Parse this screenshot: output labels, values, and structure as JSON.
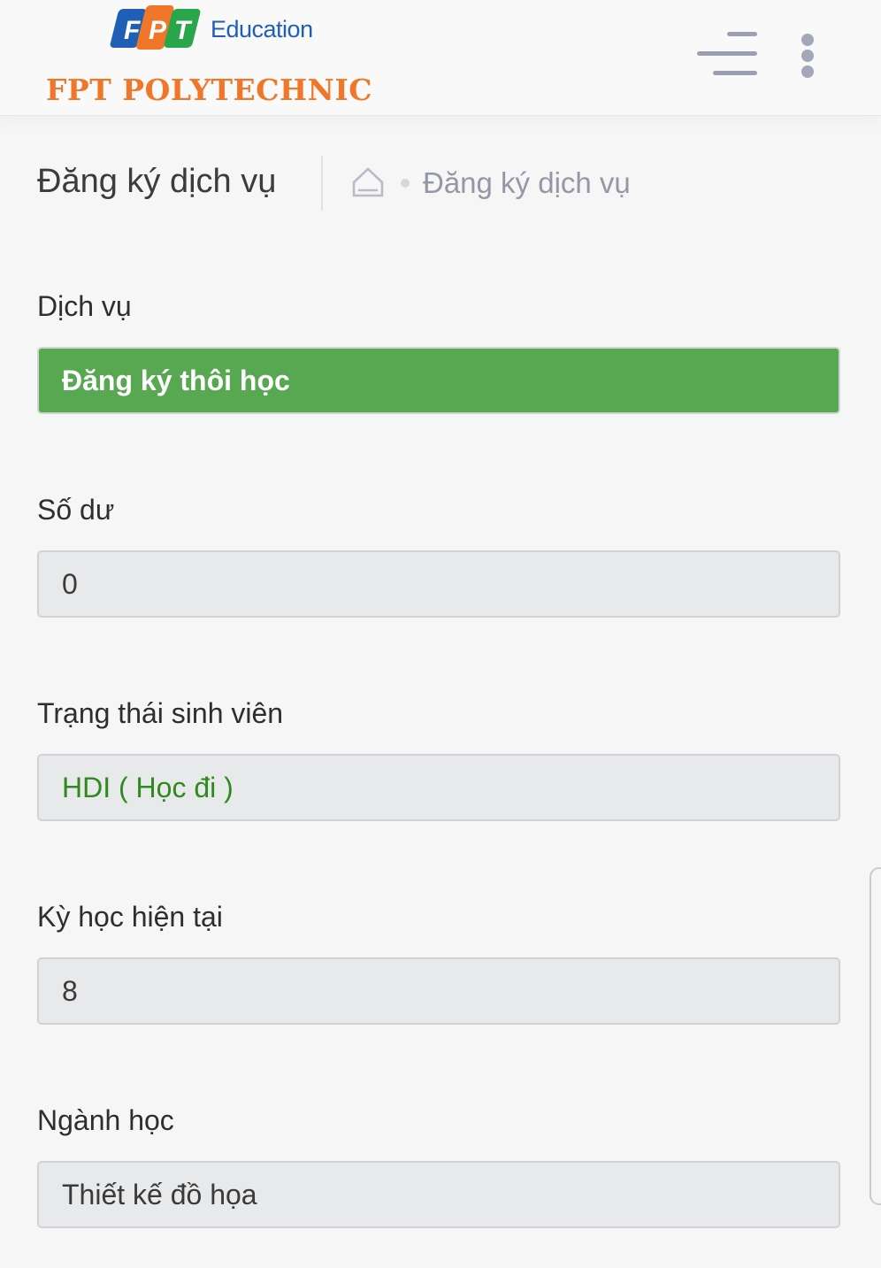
{
  "header": {
    "brand": {
      "logo_letters": [
        "F",
        "P",
        "T"
      ],
      "education": "Education",
      "polytechnic": "FPT POLYTECHNIC"
    },
    "menu_icon": "hamburger-menu-icon",
    "more_icon": "vertical-dots-icon"
  },
  "page": {
    "title": "Đăng ký dịch vụ",
    "breadcrumb": {
      "home_icon": "home-icon",
      "current": "Đăng ký dịch vụ"
    }
  },
  "form": {
    "service": {
      "label": "Dịch vụ",
      "value": "Đăng ký thôi học"
    },
    "balance": {
      "label": "Số dư",
      "value": "0"
    },
    "student_status": {
      "label": "Trạng thái sinh viên",
      "value": "HDI ( Học đi )"
    },
    "current_term": {
      "label": "Kỳ học hiện tại",
      "value": "8"
    },
    "major": {
      "label": "Ngành học",
      "value": "Thiết kế đồ họa"
    }
  },
  "colors": {
    "brand_orange": "#f0772a",
    "brand_blue": "#1f5fb5",
    "brand_green": "#2aa64a",
    "service_green": "#58a852",
    "status_green": "#2f8a1e"
  }
}
